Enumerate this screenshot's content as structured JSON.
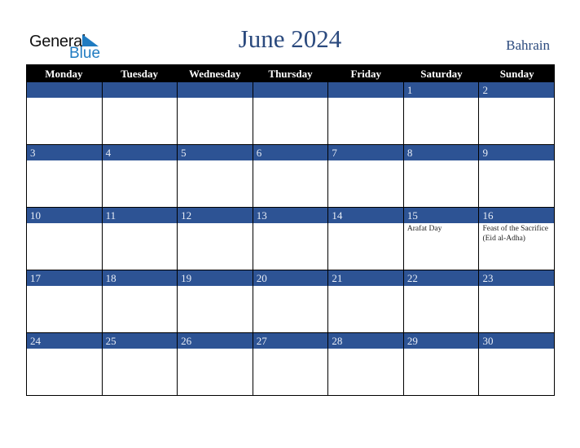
{
  "logo": {
    "general": "General",
    "blue": "Blue"
  },
  "header": {
    "title": "June 2024",
    "country": "Bahrain"
  },
  "weekdays": [
    "Monday",
    "Tuesday",
    "Wednesday",
    "Thursday",
    "Friday",
    "Saturday",
    "Sunday"
  ],
  "weeks": [
    [
      {
        "day": ""
      },
      {
        "day": ""
      },
      {
        "day": ""
      },
      {
        "day": ""
      },
      {
        "day": ""
      },
      {
        "day": "1"
      },
      {
        "day": "2"
      }
    ],
    [
      {
        "day": "3"
      },
      {
        "day": "4"
      },
      {
        "day": "5"
      },
      {
        "day": "6"
      },
      {
        "day": "7"
      },
      {
        "day": "8"
      },
      {
        "day": "9"
      }
    ],
    [
      {
        "day": "10"
      },
      {
        "day": "11"
      },
      {
        "day": "12"
      },
      {
        "day": "13"
      },
      {
        "day": "14"
      },
      {
        "day": "15",
        "event": "Arafat Day"
      },
      {
        "day": "16",
        "event": "Feast of the Sacrifice (Eid al-Adha)"
      }
    ],
    [
      {
        "day": "17"
      },
      {
        "day": "18"
      },
      {
        "day": "19"
      },
      {
        "day": "20"
      },
      {
        "day": "21"
      },
      {
        "day": "22"
      },
      {
        "day": "23"
      }
    ],
    [
      {
        "day": "24"
      },
      {
        "day": "25"
      },
      {
        "day": "26"
      },
      {
        "day": "27"
      },
      {
        "day": "28"
      },
      {
        "day": "29"
      },
      {
        "day": "30"
      }
    ]
  ]
}
